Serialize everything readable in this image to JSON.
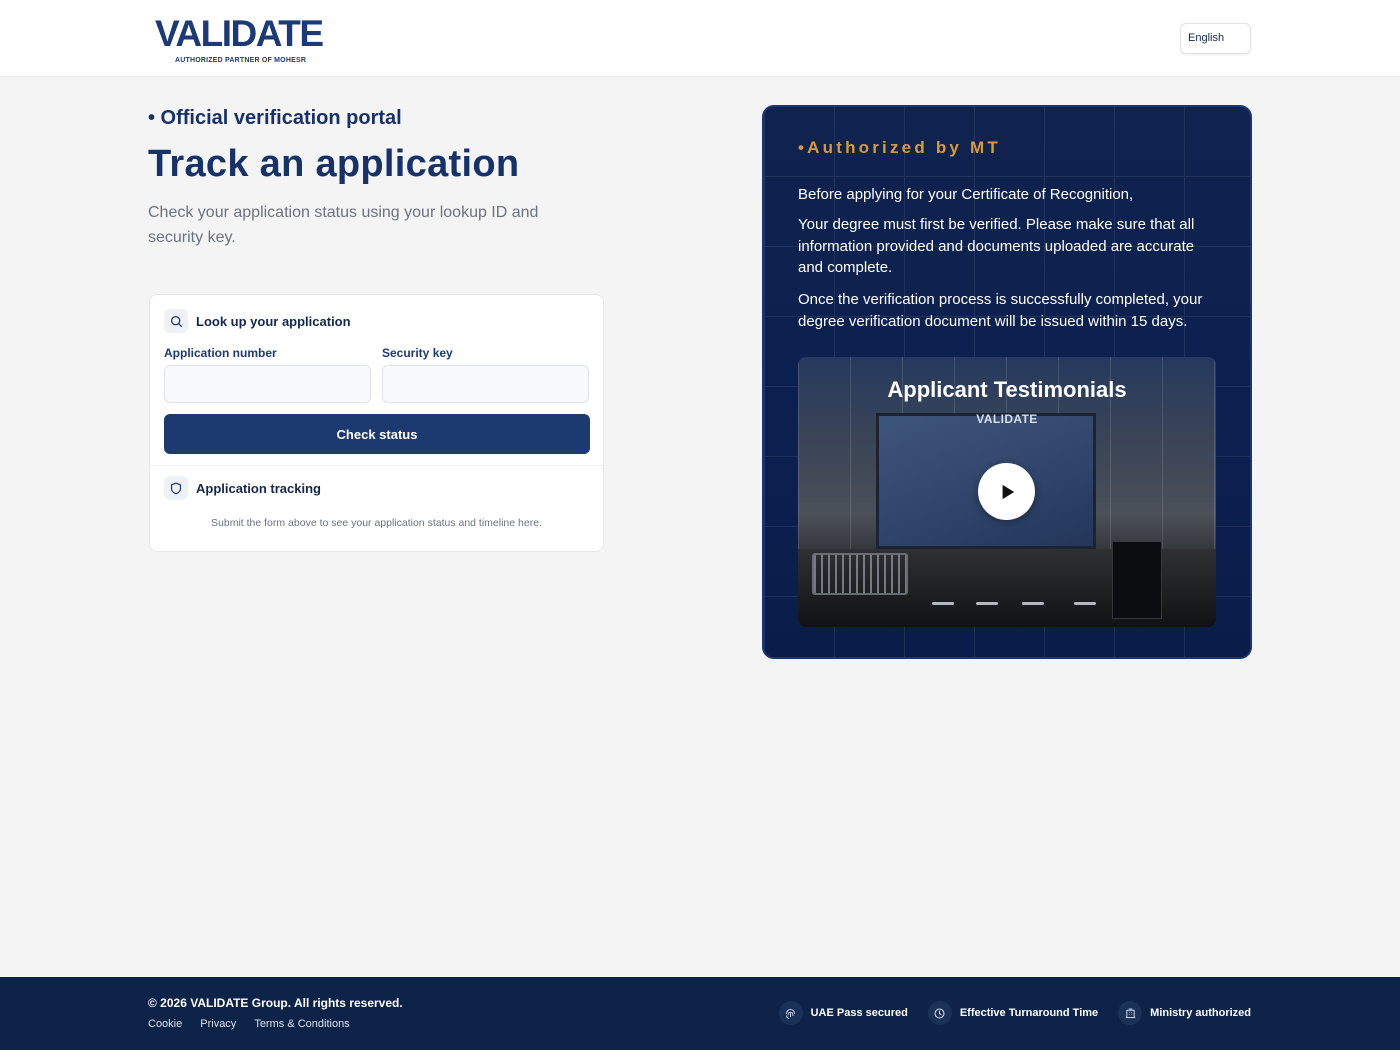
{
  "header": {
    "logo_text": "VALIDATE",
    "logo_tagline": "AUTHORIZED PARTNER OF MOHESR",
    "language": "English"
  },
  "main": {
    "eyebrow": "• Official verification portal",
    "title": "Track an application",
    "description": "Check your application status using your lookup ID and security key."
  },
  "lookup": {
    "title": "Look up your application",
    "app_number_label": "Application number",
    "app_number_value": "",
    "security_key_label": "Security key",
    "security_key_value": "",
    "submit_label": "Check status"
  },
  "tracking": {
    "title": "Application tracking",
    "note": "Submit the form above to see your application status and timeline here."
  },
  "panel": {
    "badge": "•Authorized by MT",
    "paragraphs": [
      "Before applying for your Certificate of Recognition,",
      "Your degree must first be verified. Please make sure that all information provided and documents uploaded are accurate and complete.",
      "Once the verification process is successfully completed, your degree verification document will be issued within 15 days."
    ],
    "video": {
      "title": "Applicant Testimonials",
      "subtitle": "VALIDATE",
      "play_icon": "play-icon"
    }
  },
  "footer": {
    "copyright": "© 2026 VALIDATE Group. All rights reserved.",
    "links": [
      "Cookie",
      "Privacy",
      "Terms & Conditions"
    ],
    "badges": [
      {
        "label": "UAE Pass secured",
        "icon": "fingerprint-icon"
      },
      {
        "label": "Effective Turnaround Time",
        "icon": "clock-icon"
      },
      {
        "label": "Ministry authorized",
        "icon": "building-icon"
      }
    ]
  },
  "colors": {
    "brand_navy": "#173268",
    "button_navy": "#1c3a70",
    "panel_bg": "#0c2050",
    "accent_gold": "#d99a3c",
    "footer_bg": "#0d2348",
    "page_bg": "#f4f4f5"
  }
}
